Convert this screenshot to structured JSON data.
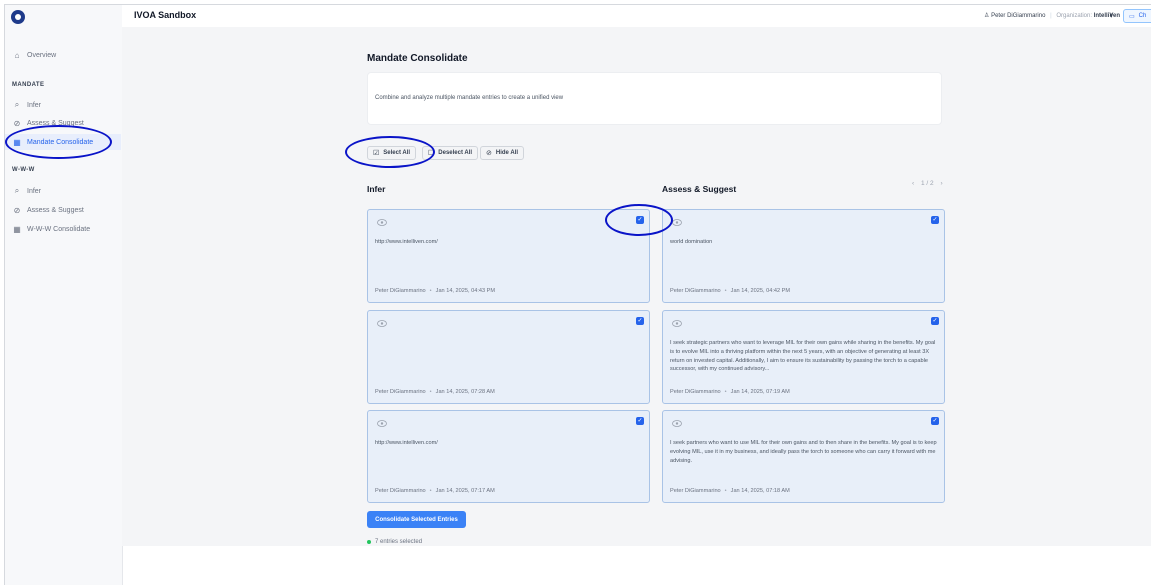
{
  "app": {
    "title": "IVOA Sandbox"
  },
  "header": {
    "user_name": "Peter DiGiammarino",
    "org_label": "Organization:",
    "org_name": "IntelliVen",
    "chat_label": "Ch"
  },
  "sidebar": {
    "overview": "Overview",
    "section_mandate": "MANDATE",
    "mandate_items": [
      {
        "label": "Infer",
        "icon": "search-icon"
      },
      {
        "label": "Assess & Suggest",
        "icon": "check-circle-icon"
      },
      {
        "label": "Mandate Consolidate",
        "icon": "grid-icon",
        "active": true
      }
    ],
    "section_www": "W-W-W",
    "www_items": [
      {
        "label": "Infer",
        "icon": "search-icon"
      },
      {
        "label": "Assess & Suggest",
        "icon": "check-circle-icon"
      },
      {
        "label": "W-W-W Consolidate",
        "icon": "grid-icon"
      }
    ]
  },
  "main": {
    "title": "Mandate Consolidate",
    "description": "Combine and analyze multiple mandate entries to create a unified view",
    "toolbar": {
      "select_all": "Select All",
      "deselect_all": "Deselect All",
      "hide_all": "Hide All"
    },
    "infer_title": "Infer",
    "assess_title": "Assess & Suggest",
    "pager": "1 / 2",
    "infer_cards": [
      {
        "text": "http://www.intelliven.com/",
        "author": "Peter DiGiammarino",
        "date": "Jan 14, 2025, 04:43 PM"
      },
      {
        "text": "",
        "author": "Peter DiGiammarino",
        "date": "Jan 14, 2025, 07:28 AM"
      },
      {
        "text": "http://www.intelliven.com/",
        "author": "Peter DiGiammarino",
        "date": "Jan 14, 2025, 07:17 AM"
      }
    ],
    "assess_cards": [
      {
        "text": "world domination",
        "author": "Peter DiGiammarino",
        "date": "Jan 14, 2025, 04:42 PM"
      },
      {
        "text": "I seek strategic partners who want to leverage MIL for their own gains while sharing in the benefits. My goal is to evolve MIL into a thriving platform within the next 5 years, with an objective of generating at least 3X return on invested capital. Additionally, I aim to ensure its sustainability by passing the torch to a capable successor, with my continued advisory...",
        "author": "Peter DiGiammarino",
        "date": "Jan 14, 2025, 07:19 AM"
      },
      {
        "text": "I seek partners who want to use MIL for their own gains and to then share in the benefits. My goal is to keep evolving MIL, use it in my business, and ideally pass the torch to someone who can carry it forward with me advising.",
        "author": "Peter DiGiammarino",
        "date": "Jan 14, 2025, 07:18 AM"
      }
    ],
    "consolidate_button": "Consolidate Selected Entries",
    "selected_count": "7 entries selected"
  }
}
